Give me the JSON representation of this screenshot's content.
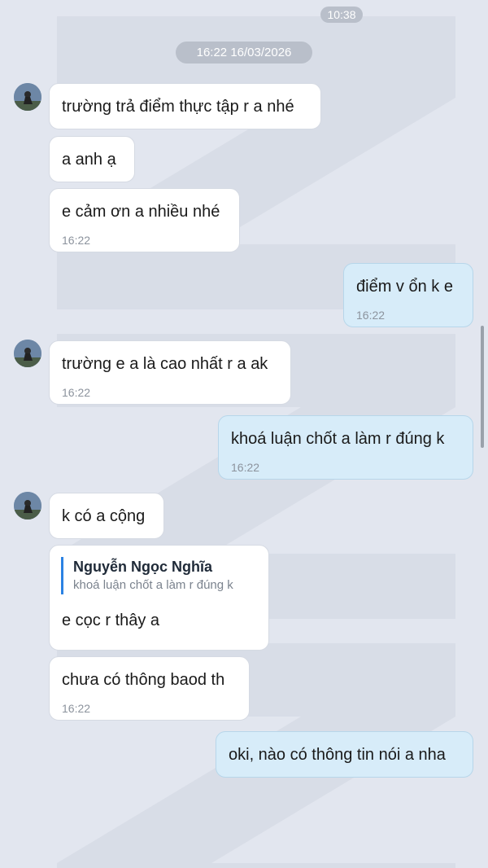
{
  "status_bar": {
    "time": "10:38"
  },
  "date_divider": "16:22 16/03/2026",
  "messages": [
    {
      "text": "trường trả điểm thực tập r a nhé"
    },
    {
      "text": "a anh ạ"
    },
    {
      "text": "e cảm ơn a nhiều nhé",
      "time": "16:22"
    },
    {
      "text": "điểm v ổn k e",
      "time": "16:22"
    },
    {
      "text": "trường e a là cao nhất r a ak",
      "time": "16:22"
    },
    {
      "text": "khoá luận chốt a làm r đúng k",
      "time": "16:22"
    },
    {
      "text": "k có a cộng"
    },
    {
      "quote_name": "Nguyễn Ngọc Nghĩa",
      "quote_text": "khoá luận chốt a làm r đúng k",
      "text": "e cọc r thây a"
    },
    {
      "text": "chưa có thông baod th",
      "time": "16:22"
    },
    {
      "text": "oki, nào có thông tin nói a nha"
    }
  ]
}
